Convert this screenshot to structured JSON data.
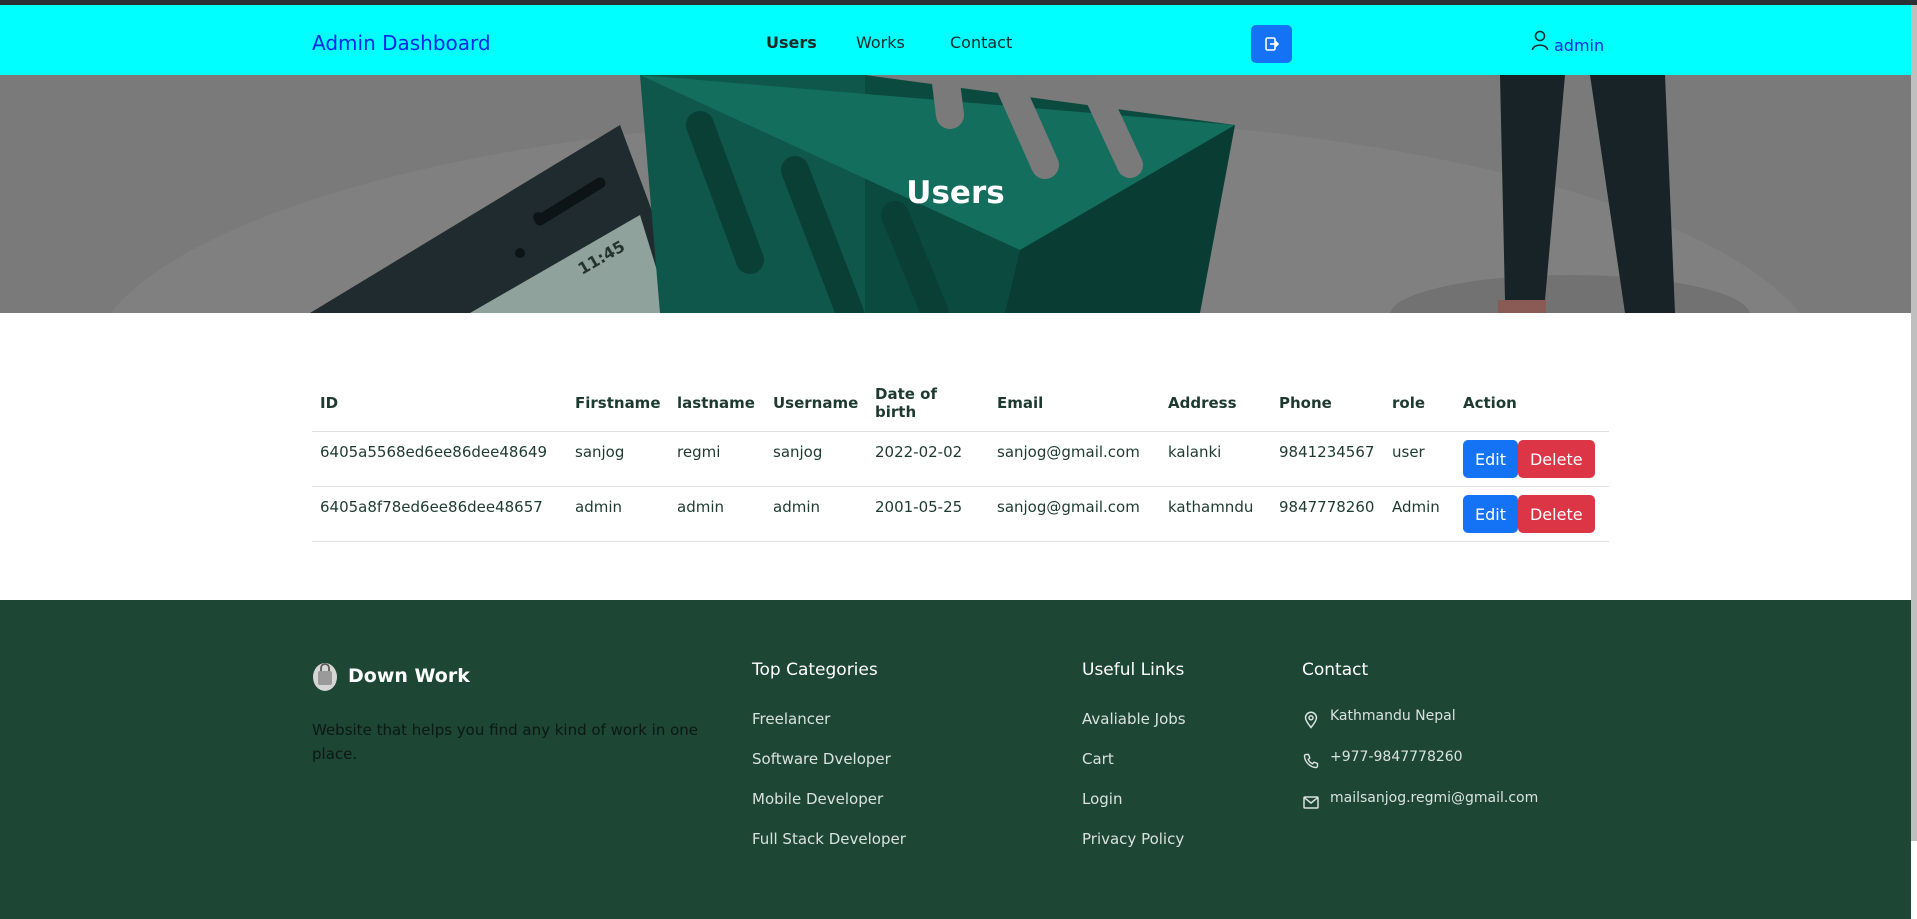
{
  "nav": {
    "brand": "Admin Dashboard",
    "links": [
      "Users",
      "Works",
      "Contact"
    ],
    "active": "Users",
    "logout_icon": "logout-icon",
    "user_icon": "user-icon",
    "username": "admin"
  },
  "hero": {
    "title": "Users",
    "phone_time": "11:45"
  },
  "table": {
    "headers": [
      "ID",
      "Firstname",
      "lastname",
      "Username",
      "Date of birth",
      "Email",
      "Address",
      "Phone",
      "role",
      "Action"
    ],
    "rows": [
      {
        "id": "6405a5568ed6ee86dee48649",
        "firstname": "sanjog",
        "lastname": "regmi",
        "username": "sanjog",
        "dob": "2022-02-02",
        "email": "sanjog@gmail.com",
        "address": "kalanki",
        "phone": "9841234567",
        "role": "user"
      },
      {
        "id": "6405a8f78ed6ee86dee48657",
        "firstname": "admin",
        "lastname": "admin",
        "username": "admin",
        "dob": "2001-05-25",
        "email": "sanjog@gmail.com",
        "address": "kathamndu",
        "phone": "9847778260",
        "role": "Admin"
      }
    ],
    "edit_label": "Edit",
    "delete_label": "Delete"
  },
  "footer": {
    "brand": "Down Work",
    "brand_icon": "shopping-bag-icon",
    "description": "Website that helps you find any kind of work in one place.",
    "categories": {
      "title": "Top Categories",
      "items": [
        "Freelancer",
        "Software Dveloper",
        "Mobile Developer",
        "Full Stack Developer"
      ]
    },
    "useful": {
      "title": "Useful Links",
      "items": [
        "Avaliable Jobs",
        "Cart",
        "Login",
        "Privacy Policy"
      ]
    },
    "contact": {
      "title": "Contact",
      "location": "Kathmandu Nepal",
      "phone": "+977-9847778260",
      "email": "mailsanjog.regmi@gmail.com"
    }
  },
  "colors": {
    "nav_bg": "#00ffff",
    "brand": "#0d28e6",
    "primary": "#1473f5",
    "danger": "#dc3545",
    "footer_bg": "#1d4634"
  }
}
